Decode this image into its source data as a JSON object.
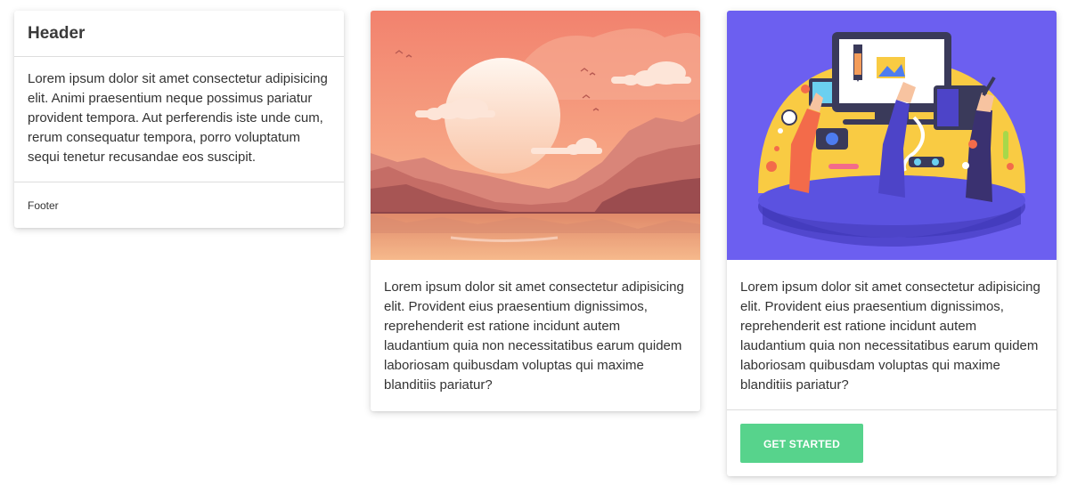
{
  "card1": {
    "header": "Header",
    "body": "Lorem ipsum dolor sit amet consectetur adipisicing elit. Animi praesentium neque possimus pariatur provident tempora. Aut perferendis iste unde cum, rerum consequatur tempora, porro voluptatum sequi tenetur recusandae eos suscipit.",
    "footer": "Footer"
  },
  "card2": {
    "image": "sunset-landscape-illustration",
    "body": "Lorem ipsum dolor sit amet consectetur adipisicing elit. Provident eius praesentium dignissimos, reprehenderit est ratione incidunt autem laudantium quia non necessitatibus earum quidem laboriosam quibusdam voluptas qui maxime blanditiis pariatur?"
  },
  "card3": {
    "image": "workspace-hands-illustration",
    "body": "Lorem ipsum dolor sit amet consectetur adipisicing elit. Provident eius praesentium dignissimos, reprehenderit est ratione incidunt autem laudantium quia non necessitatibus earum quidem laboriosam quibusdam voluptas qui maxime blanditiis pariatur?",
    "button_label": "GET STARTED"
  },
  "colors": {
    "button_bg": "#57d38c",
    "card3_image_bg": "#6c5ff0"
  }
}
